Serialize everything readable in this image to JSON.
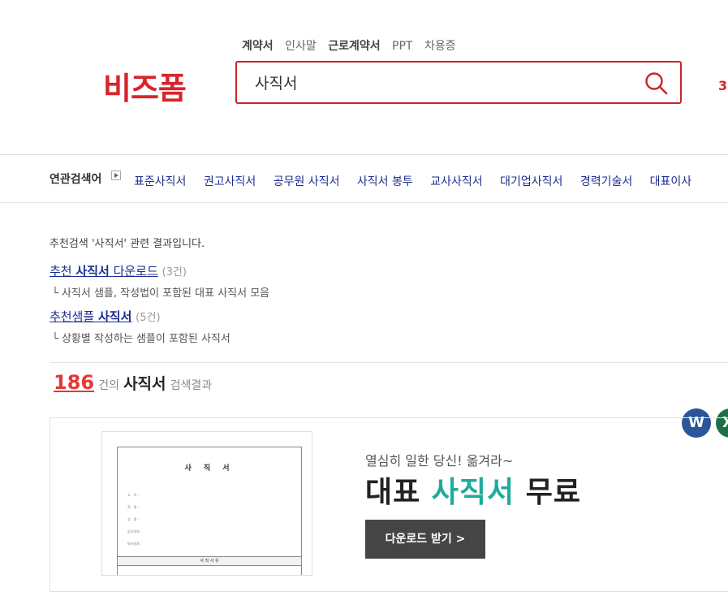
{
  "header": {
    "logo": "비즈폼",
    "popular_keywords": [
      {
        "label": "계약서",
        "strong": true
      },
      {
        "label": "인사말",
        "strong": false
      },
      {
        "label": "근로계약서",
        "strong": true
      },
      {
        "label": "PPT",
        "strong": false
      },
      {
        "label": "차용증",
        "strong": false
      }
    ],
    "search_value": "사직서",
    "right_partial": "3"
  },
  "related": {
    "title": "연관검색어",
    "items": [
      "표준사직서",
      "권고사직서",
      "공무원 사직서",
      "사직서 봉투",
      "교사사직서",
      "대기업사직서",
      "경력기술서",
      "대표이사"
    ]
  },
  "recommend": {
    "intro": "추천검색 '사직서' 관련 결과입니다.",
    "item1": {
      "prefix": "추천",
      "keyword": "사직서",
      "suffix": "다운로드",
      "count": "(3건)",
      "desc": "└ 사직서 샘플, 작성법이 포함된 대표 사직서 모음"
    },
    "item2": {
      "prefix": "추천샘플",
      "keyword": "사직서",
      "count": "(5건)",
      "desc": "└ 상황별 작성하는 샘플이 포함된 사직서"
    }
  },
  "results": {
    "count": "186",
    "unit": "건의",
    "query": "사직서",
    "label": "검색결과"
  },
  "formats": {
    "word": "W",
    "excel": "X"
  },
  "banner": {
    "doc_title": "사 직 서",
    "doc_fields": [
      "소　속 :",
      "직　위 :",
      "성　명 :",
      "입사일자 :",
      "퇴사일자 :"
    ],
    "doc_band": "사 직 사 유",
    "tagline": "열심히 일한 당신! 옮겨라~",
    "headline_pre": "대표",
    "headline_hl": "사직서",
    "headline_post": "무료",
    "button": "다운로드 받기 >"
  },
  "colors": {
    "brand": "#d7252b",
    "highlight": "#1fab9c",
    "link": "#1b2d8f"
  }
}
